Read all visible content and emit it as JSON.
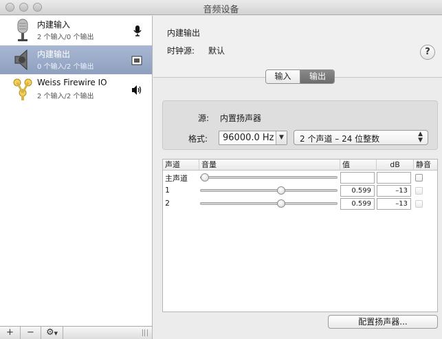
{
  "window": {
    "title": "音频设备"
  },
  "devices": [
    {
      "name": "内建输入",
      "sub": "2 个输入/0 个输出",
      "badge": "microphone-icon"
    },
    {
      "name": "内建输出",
      "sub": "0 个输入/2 个输出",
      "badge": "finder-icon"
    },
    {
      "name": "Weiss Firewire IO",
      "sub": "2 个输入/2 个输出",
      "badge": "speaker-icon"
    }
  ],
  "sidebar_bar": {
    "add": "+",
    "remove": "−"
  },
  "header": {
    "title": "内建输出",
    "clock_label": "时钟源:",
    "clock_value": "默认",
    "help": "?"
  },
  "tabs": {
    "input": "输入",
    "output": "输出"
  },
  "settings": {
    "source_label": "源:",
    "source_value": "内置扬声器",
    "format_label": "格式:",
    "rate_value": "96000.0 Hz",
    "channels_value": "2 个声道 – 24 位整数"
  },
  "table": {
    "headers": [
      "声道",
      "音量",
      "值",
      "dB",
      "静音"
    ],
    "rows": [
      {
        "label": "主声道",
        "level": 0,
        "value": "",
        "db": ""
      },
      {
        "label": "1",
        "level": 0.599,
        "value": "0.599",
        "db": "–13"
      },
      {
        "label": "2",
        "level": 0.599,
        "value": "0.599",
        "db": "–13"
      }
    ]
  },
  "configure_button": "配置扬声器..."
}
